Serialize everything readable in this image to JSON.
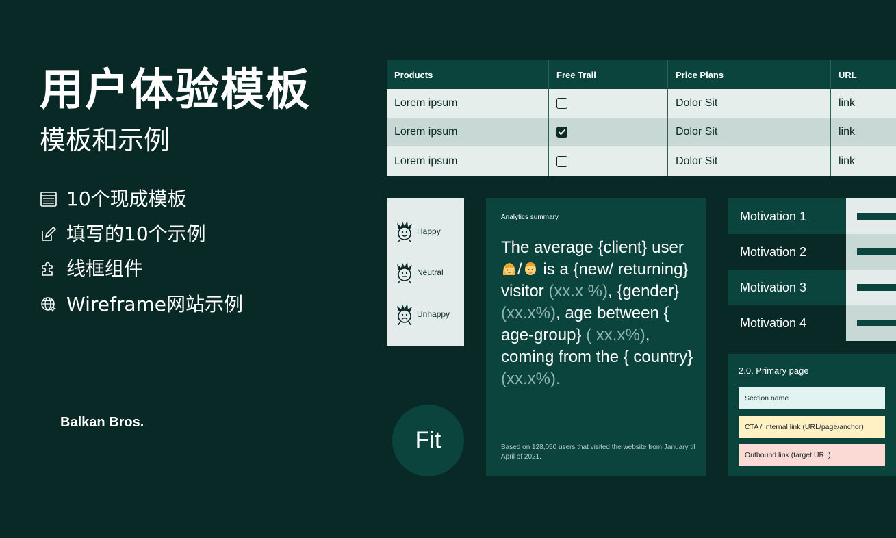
{
  "colors": {
    "background": "#082926",
    "panel": "#0b443d",
    "light_row": "#e6eeec",
    "mid_row": "#c7d8d5",
    "chip_section": "#e2f4f2",
    "chip_cta": "#fff1c4",
    "chip_outbound": "#fbdad5"
  },
  "title": "用户体验模板",
  "subtitle": "模板和示例",
  "features": [
    {
      "icon": "layout-icon",
      "label": "10个现成模板"
    },
    {
      "icon": "edit-icon",
      "label": "填写的10个示例"
    },
    {
      "icon": "puzzle-icon",
      "label": "线框组件"
    },
    {
      "icon": "globe-icon",
      "label": "Wireframe网站示例"
    }
  ],
  "brand": "Balkan Bros.",
  "table": {
    "headers": [
      "Products",
      "Free Trail",
      "Price Plans",
      "URL"
    ],
    "rows": [
      {
        "product": "Lorem ipsum",
        "free_trial_checked": false,
        "price": "Dolor Sit",
        "url": "link"
      },
      {
        "product": "Lorem ipsum",
        "free_trial_checked": true,
        "price": "Dolor Sit",
        "url": "link"
      },
      {
        "product": "Lorem ipsum",
        "free_trial_checked": false,
        "price": "Dolor Sit",
        "url": "link"
      }
    ]
  },
  "moods": [
    "Happy",
    "Neutral",
    "Unhappy"
  ],
  "fit": "Fit",
  "analytics": {
    "title": "Analytics summary",
    "body_1": "The average {client} user ",
    "body_slash": "/",
    "body_2": " is a {new/ returning} visitor ",
    "pct_1": "(xx.x %)",
    "body_3": ", {gender} ",
    "pct_2": "(xx.x%)",
    "body_4": ", age between { age-group} ",
    "pct_3": "( xx.x%)",
    "body_5": ", coming from the { country} ",
    "pct_4": "(xx.x%)",
    "body_6": ".",
    "footnote": "Based on 128,050 users that visited the website from January til April of 2021."
  },
  "motivations": [
    "Motivation 1",
    "Motivation 2",
    "Motivation 3",
    "Motivation 4"
  ],
  "primary_page": {
    "title": "2.0.  Primary page",
    "chips": [
      "Section name",
      "CTA / internal link (URL/page/anchor)",
      "Outbound link (target URL)"
    ]
  }
}
